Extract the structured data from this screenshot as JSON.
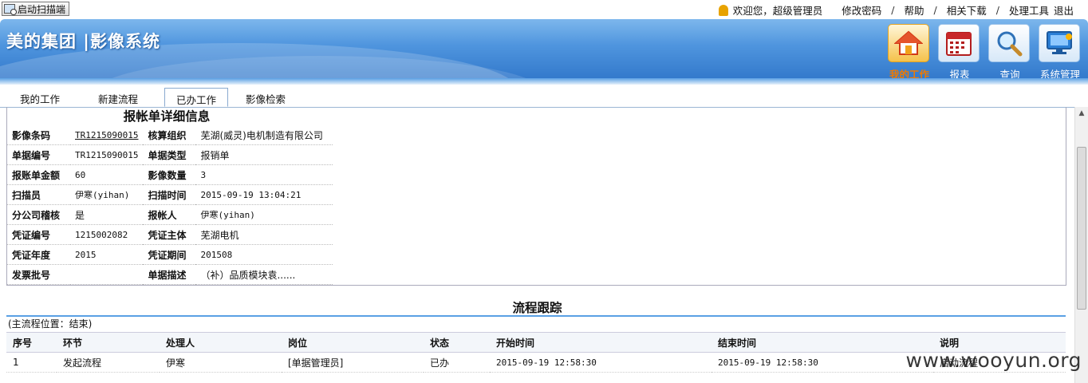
{
  "topbar": {
    "scan_button": "启动扫描端",
    "welcome": "欢迎您，超级管理员",
    "links": [
      "修改密码",
      "帮助",
      "相关下载",
      "处理工具"
    ],
    "logout": "退出"
  },
  "banner": {
    "brand": "美的集团 |影像系统",
    "nav": [
      {
        "label": "我的工作",
        "icon": "home-icon",
        "active": true
      },
      {
        "label": "报表",
        "icon": "calendar-icon"
      },
      {
        "label": "查询",
        "icon": "magnifier-icon"
      },
      {
        "label": "系统管理",
        "icon": "monitor-icon"
      }
    ]
  },
  "tabs": [
    "我的工作",
    "新建流程",
    "已办工作",
    "影像检索"
  ],
  "detail": {
    "title": "报帐单详细信息",
    "rows": [
      {
        "k1": "影像条码",
        "v1": "TR1215090015",
        "k2": "核算组织",
        "v2": "芜湖(威灵)电机制造有限公司"
      },
      {
        "k1": "单据编号",
        "v1": "TR1215090015",
        "k2": "单据类型",
        "v2": "报销单"
      },
      {
        "k1": "报账单金额",
        "v1": "60",
        "k2": "影像数量",
        "v2": "3"
      },
      {
        "k1": "扫描员",
        "v1": "伊寒(yihan)",
        "k2": "扫描时间",
        "v2": "2015-09-19 13:04:21"
      },
      {
        "k1": "分公司稽核",
        "v1": "是",
        "k2": "报帐人",
        "v2": "伊寒(yihan)"
      },
      {
        "k1": "凭证编号",
        "v1": "1215002082",
        "k2": "凭证主体",
        "v2": "芜湖电机"
      },
      {
        "k1": "凭证年度",
        "v1": "2015",
        "k2": "凭证期间",
        "v2": "201508"
      },
      {
        "k1": "发票批号",
        "v1": "",
        "k2": "单据描述",
        "v2": "（补）品质模块袁......"
      }
    ]
  },
  "flow": {
    "title": "流程跟踪",
    "position": "(主流程位置：结束)",
    "headers": [
      "序号",
      "环节",
      "处理人",
      "岗位",
      "状态",
      "开始时间",
      "结束时间",
      "说明"
    ],
    "rows": [
      [
        "1",
        "发起流程",
        "伊寒",
        "[单据管理员]",
        "已办",
        "2015-09-19 12:58:30",
        "2015-09-19 12:58:30",
        "启动流程"
      ]
    ]
  },
  "watermark": "www.wooyun.org"
}
